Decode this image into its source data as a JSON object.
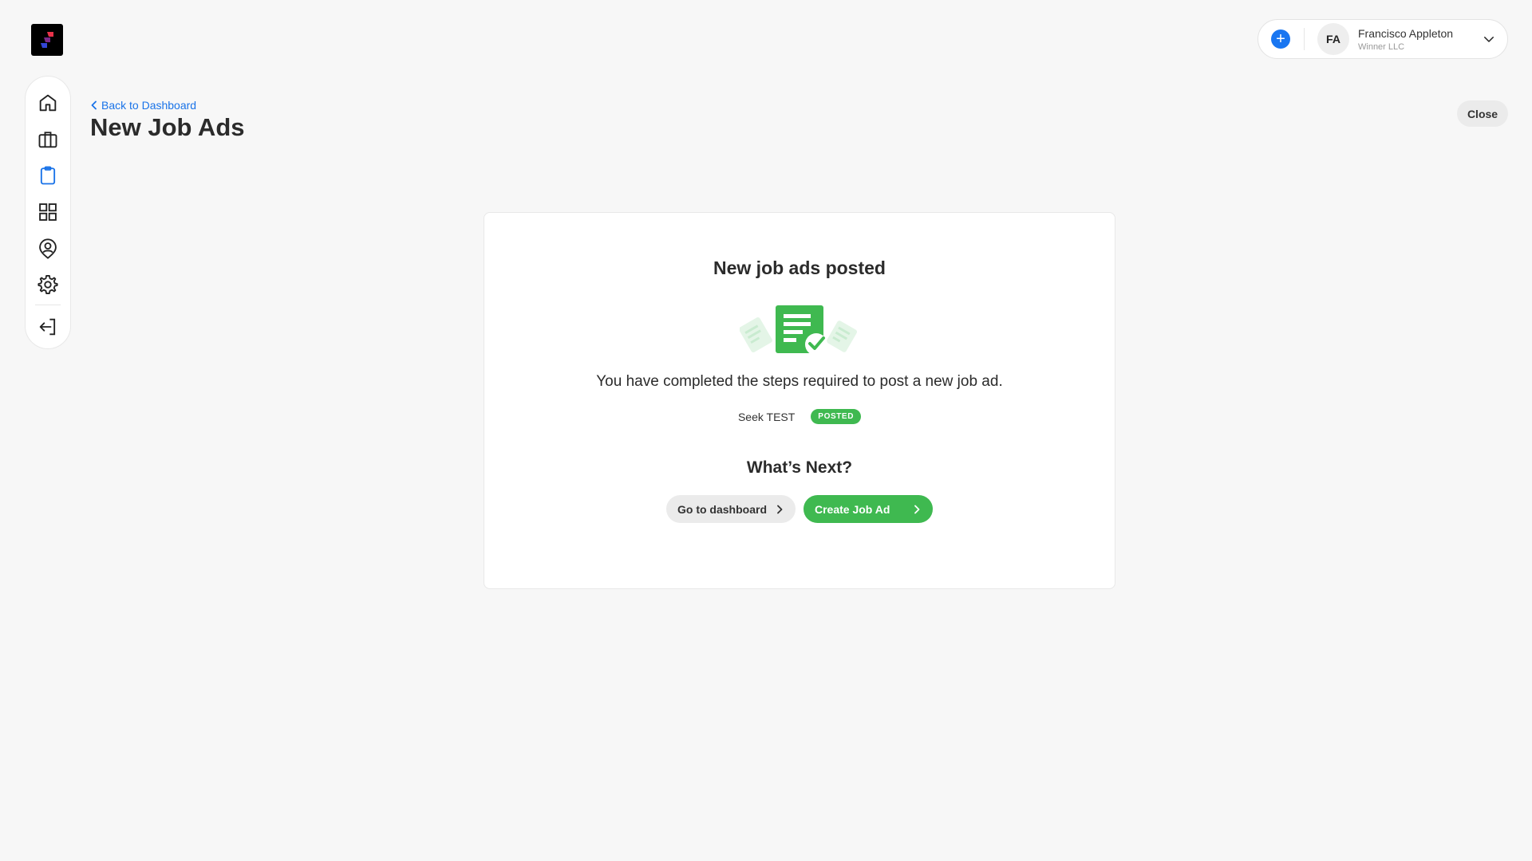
{
  "app": {
    "logo_name": "app-logo"
  },
  "sidebar": {
    "items": [
      {
        "icon": "home-icon",
        "active": false
      },
      {
        "icon": "briefcase-icon",
        "active": false
      },
      {
        "icon": "clipboard-icon",
        "active": true
      },
      {
        "icon": "grid-icon",
        "active": false
      },
      {
        "icon": "user-pin-icon",
        "active": false
      },
      {
        "icon": "gear-icon",
        "active": false
      },
      {
        "icon": "logout-icon",
        "active": false
      }
    ]
  },
  "header": {
    "user_initials": "FA",
    "user_name": "Francisco Appleton",
    "user_company": "Winner LLC",
    "add_label": "+"
  },
  "page": {
    "back_label": "Back to Dashboard",
    "title": "New Job Ads",
    "close_label": "Close"
  },
  "card": {
    "title": "New job ads posted",
    "message": "You have completed the steps required to post a new job ad.",
    "board_name": "Seek TEST",
    "status_badge": "POSTED",
    "next_title": "What’s Next?",
    "dashboard_button": "Go to dashboard",
    "create_button": "Create Job Ad"
  },
  "colors": {
    "accent_blue": "#1a73e8",
    "success_green": "#3fb950",
    "background": "#f7f7f7"
  }
}
